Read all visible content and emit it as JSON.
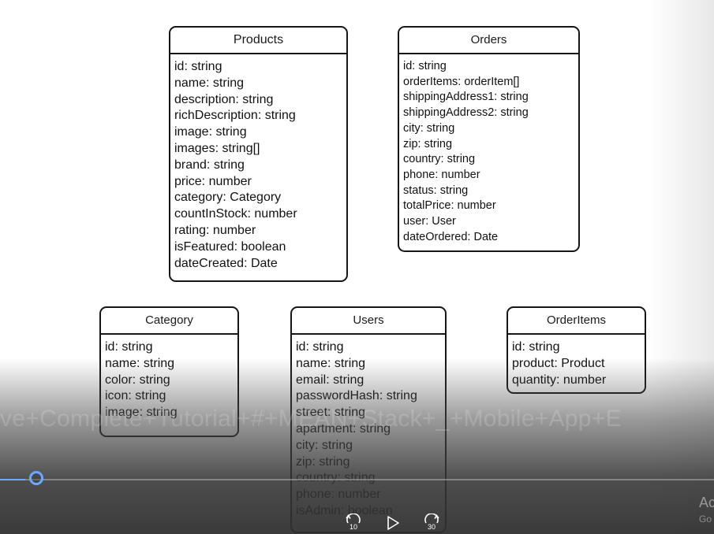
{
  "diagram": {
    "entities": [
      {
        "id": "products",
        "title": "Products",
        "fields": [
          "id: string",
          "name: string",
          "description: string",
          "richDescription: string",
          "image: string",
          "images: string[]",
          "brand: string",
          "price: number",
          "category: Category",
          "countInStock: number",
          "rating: number",
          "isFeatured: boolean",
          "dateCreated: Date"
        ]
      },
      {
        "id": "orders",
        "title": "Orders",
        "fields": [
          "id: string",
          "orderItems: orderItem[]",
          "shippingAddress1: string",
          "shippingAddress2: string",
          "city: string",
          "zip: string",
          "country: string",
          "phone: number",
          "status: string",
          "totalPrice: number",
          "user: User",
          "dateOrdered: Date"
        ]
      },
      {
        "id": "category",
        "title": "Category",
        "fields": [
          "id: string",
          "name: string",
          "color: string",
          "icon: string",
          "image: string"
        ]
      },
      {
        "id": "users",
        "title": "Users",
        "fields": [
          "id: string",
          "name: string",
          "email: string",
          "passwordHash: string",
          "street: string",
          "apartment: string",
          "city: string",
          "zip: string",
          "country: string",
          "phone: number",
          "isAdmin: boolean"
        ]
      },
      {
        "id": "orderitems",
        "title": "OrderItems",
        "fields": [
          "id: string",
          "product: Product",
          "quantity: number"
        ]
      }
    ]
  },
  "player": {
    "ghost_title": "ve+Complete+Tutorial+#+MEAN+Stack+_+Mobile+App+E",
    "progress_fraction": 0.035,
    "seek_back_seconds": "10",
    "seek_forward_seconds": "30",
    "corner_text": "Ac",
    "corner_subtext": "Go",
    "accent_color": "#6aa8ff",
    "icons": {
      "seek_back": "rewind-10-icon",
      "play": "play-icon",
      "seek_forward": "forward-30-icon"
    }
  }
}
